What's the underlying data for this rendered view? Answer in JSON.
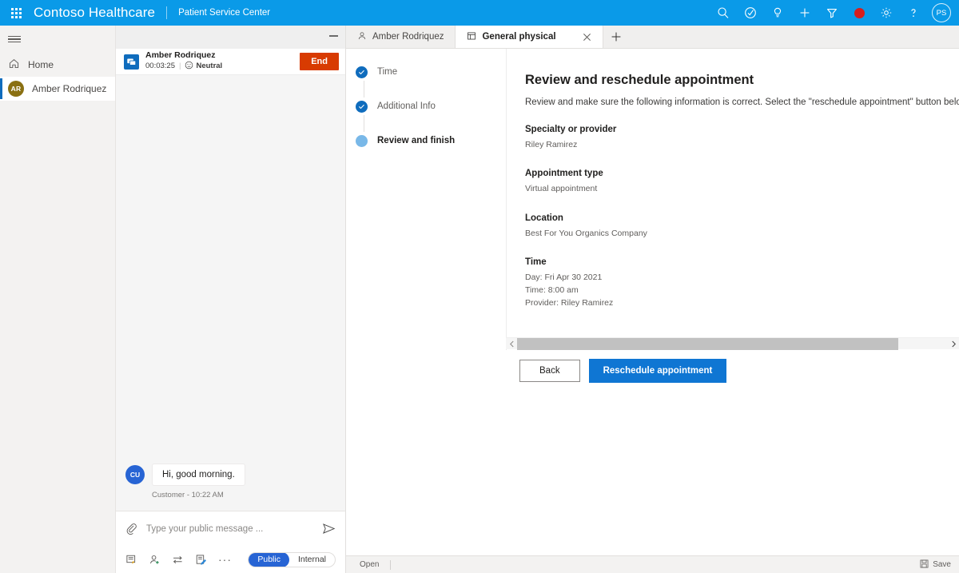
{
  "topbar": {
    "waffle_icon": "app-launcher-icon",
    "app_title": "Contoso Healthcare",
    "app_subtitle": "Patient Service Center",
    "actions": [
      {
        "name": "search-icon",
        "label": "Search"
      },
      {
        "name": "assistant-icon",
        "label": "Assistant"
      },
      {
        "name": "lightbulb-icon",
        "label": "Insights"
      },
      {
        "name": "plus-icon",
        "label": "New"
      },
      {
        "name": "filter-icon",
        "label": "Filter"
      },
      {
        "name": "record-icon",
        "label": "Recording"
      },
      {
        "name": "gear-icon",
        "label": "Settings"
      },
      {
        "name": "help-icon",
        "label": "Help"
      }
    ],
    "user_initials": "PS"
  },
  "sidebar": {
    "menu_icon": "hamburger-icon",
    "items": [
      {
        "label": "Home",
        "icon": "home-icon",
        "selected": false
      },
      {
        "label": "Amber Rodriquez",
        "initials": "AR",
        "avatar_color": "#8a7012",
        "selected": true
      }
    ]
  },
  "chat": {
    "minimize_label": "Minimize",
    "conversation": {
      "customer_name": "Amber Rodriquez",
      "duration": "00:03:25",
      "sentiment": "Neutral",
      "sentiment_icon": "neutral-face-icon",
      "channel_icon": "chat-icon",
      "end_button": "End"
    },
    "messages": [
      {
        "initials": "CU",
        "avatar_color": "#2764d4",
        "text": "Hi, good morning.",
        "meta": "Customer - 10:22 AM"
      }
    ],
    "composer": {
      "attach_icon": "paperclip-icon",
      "placeholder": "Type your public message ...",
      "value": "",
      "send_icon": "send-icon",
      "tools": [
        {
          "name": "quick-replies-icon",
          "label": "Quick replies"
        },
        {
          "name": "add-agent-icon",
          "label": "Consult"
        },
        {
          "name": "transfer-icon",
          "label": "Transfer"
        },
        {
          "name": "notes-icon",
          "label": "Notes"
        },
        {
          "name": "more-options-icon",
          "label": "..."
        }
      ],
      "visibility": {
        "options": [
          "Public",
          "Internal"
        ],
        "selected": "Public"
      }
    }
  },
  "tabs": {
    "items": [
      {
        "label": "Amber Rodriquez",
        "icon": "contact-icon",
        "active": false,
        "closable": false
      },
      {
        "label": "General physical",
        "icon": "form-icon",
        "active": true,
        "closable": true
      }
    ],
    "close_icon": "close-icon",
    "new_tab_icon": "plus-icon"
  },
  "stepper": {
    "steps": [
      {
        "label": "Time",
        "state": "done"
      },
      {
        "label": "Additional Info",
        "state": "done"
      },
      {
        "label": "Review and finish",
        "state": "current"
      }
    ]
  },
  "main": {
    "title": "Review and reschedule appointment",
    "description": "Review and make sure the following information is correct. Select the \"reschedule appointment\" button below to update th",
    "fields": [
      {
        "label": "Specialty or provider",
        "value": "Riley Ramirez"
      },
      {
        "label": "Appointment type",
        "value": "Virtual appointment"
      },
      {
        "label": "Location",
        "value": "Best For You Organics Company"
      },
      {
        "label": "Time",
        "value": "Day: Fri Apr 30 2021\nTime: 8:00 am\nProvider: Riley Ramirez"
      }
    ],
    "scrollbar": {
      "left_arrow_icon": "chevron-left-icon",
      "right_arrow_icon": "chevron-right-icon",
      "thumb_percent": 88
    },
    "buttons": {
      "back": "Back",
      "primary": "Reschedule appointment"
    }
  },
  "statusbar": {
    "status": "Open",
    "save_label": "Save",
    "save_icon": "save-icon"
  },
  "colors": {
    "brand_blue": "#0a9ae8",
    "accent_blue": "#0f6cbd",
    "primary_button": "#0f76d3",
    "end_button": "#d83b01",
    "toggle_blue": "#2764d4",
    "avatar_olive": "#8a7012"
  }
}
